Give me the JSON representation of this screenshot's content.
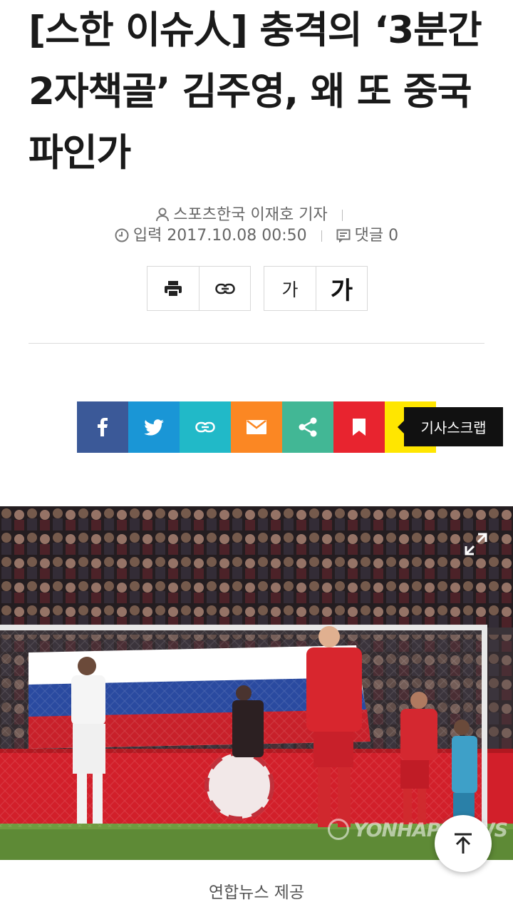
{
  "headline": {
    "line1": "[스한 이슈人] 충격의 ‘3분간",
    "line2": "2자책골’ 김주영, 왜 또 중국",
    "line3": "파인가"
  },
  "meta": {
    "byline": "스포츠한국 이재호 기자",
    "date": "입력 2017.10.08 00:50",
    "comments": "댓글 0"
  },
  "tools": {
    "font_small": "가",
    "font_large": "가"
  },
  "share": {
    "colors": {
      "facebook": "#3b5998",
      "twitter": "#1a96d6",
      "link": "#21b9c8",
      "email": "#fb8723",
      "share": "#42b795",
      "bookmark": "#e8242f",
      "scrap": "#ffe600"
    },
    "tooltip": "기사스크랩"
  },
  "photo": {
    "watermark": "YONHAP NEWS",
    "caption": "연합뉴스 제공"
  }
}
